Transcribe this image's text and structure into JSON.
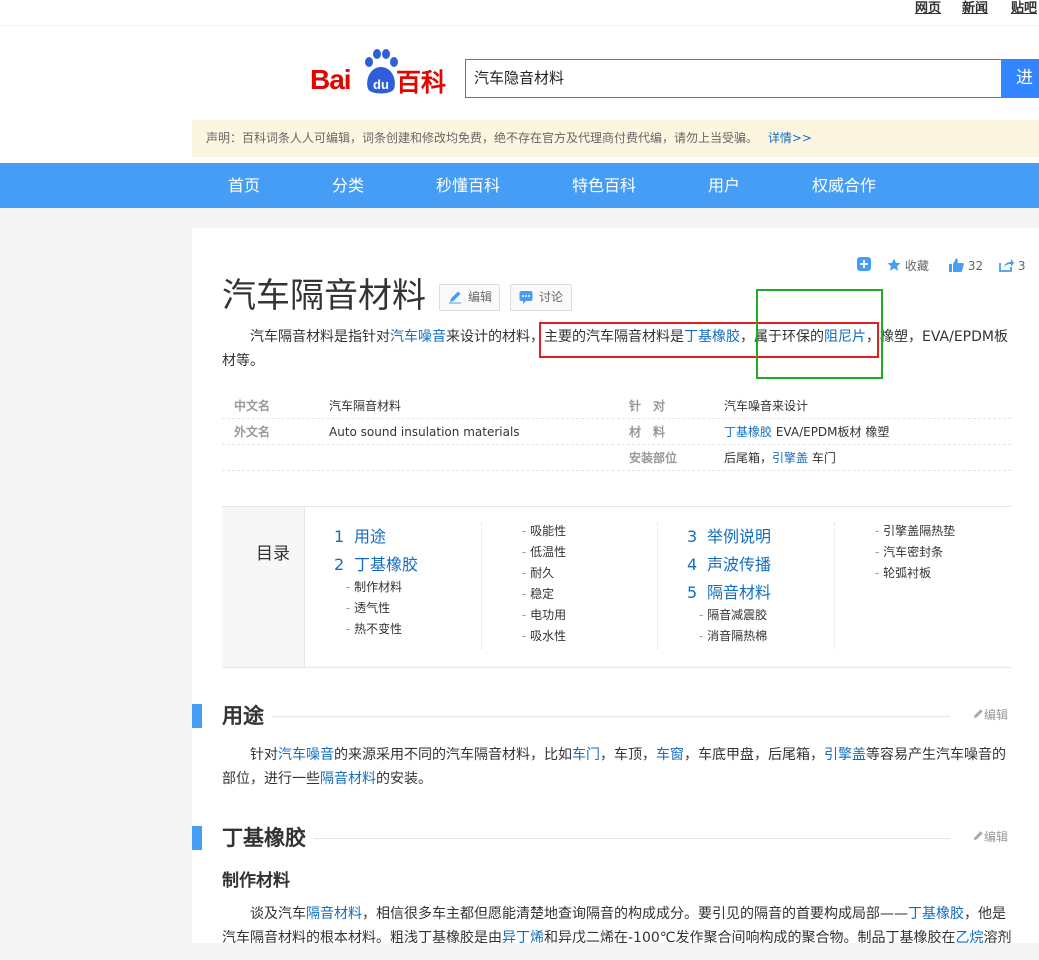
{
  "topbar": {
    "links": [
      "网页",
      "新闻",
      "贴吧"
    ]
  },
  "logo": {
    "bai": "Bai",
    "du": "du",
    "baike": "百科"
  },
  "search": {
    "value": "汽车隐音材料",
    "button": "进入"
  },
  "notice": {
    "text": "声明：百科词条人人可编辑，词条创建和修改均免费，绝不存在官方及代理商付费代编，请勿上当受骗。",
    "link": "详情>>"
  },
  "nav": [
    "首页",
    "分类",
    "秒懂百科",
    "特色百科",
    "用户",
    "权威合作"
  ],
  "tools": {
    "collect": "收藏",
    "likes": "32",
    "shares": "3"
  },
  "title": "汽车隔音材料",
  "buttons": {
    "edit": "编辑",
    "discuss": "讨论"
  },
  "summary": {
    "p1": "汽车隔音材料是指针对",
    "l1": "汽车噪音",
    "p2": "来设计的材料，主要的汽车隔音材料是",
    "l2": "丁基橡胶",
    "p3": "，属于环保的",
    "l3": "阻尼片",
    "p4": "，橡塑，EVA/EPDM板材等。"
  },
  "basic_info": {
    "left": [
      {
        "k": "中文名",
        "v": "汽车隔音材料"
      },
      {
        "k": "外文名",
        "v": "Auto sound insulation materials"
      }
    ],
    "right": [
      {
        "k": "针　对",
        "v": "汽车噪音来设计"
      },
      {
        "k": "材　料",
        "link": "丁基橡胶",
        "v": " EVA/EPDM板材 橡塑"
      },
      {
        "k": "安装部位",
        "v": "后尾箱，",
        "link": "引擎盖",
        "v2": " 车门"
      }
    ]
  },
  "catalog": {
    "title": "目录",
    "items": [
      {
        "num": "1",
        "label": "用途"
      },
      {
        "num": "2",
        "label": "丁基橡胶"
      },
      {
        "num": "3",
        "label": "举例说明"
      },
      {
        "num": "4",
        "label": "声波传播"
      },
      {
        "num": "5",
        "label": "隔音材料"
      }
    ],
    "sub2": [
      "制作材料",
      "透气性",
      "热不变性"
    ],
    "col2": [
      "吸能性",
      "低温性",
      "耐久",
      "稳定",
      "电功用",
      "吸水性"
    ],
    "sub5": [
      "隔音减震胶",
      "消音隔热棉"
    ],
    "col4": [
      "引擎盖隔热垫",
      "汽车密封条",
      "轮弧衬板"
    ]
  },
  "sections": {
    "s1": {
      "title": "用途",
      "edit": "编辑",
      "para": {
        "a": "针对",
        "l1": "汽车噪音",
        "b": "的来源采用不同的汽车隔音材料，比如",
        "l2": "车门",
        "c": "，车顶，",
        "l3": "车窗",
        "d": "，车底甲盘，后尾箱，",
        "l4": "引擎盖",
        "e": "等容易产生汽车噪音的部位，进行一些",
        "l5": "隔音材料",
        "f": "的安装。"
      }
    },
    "s2": {
      "title": "丁基橡胶",
      "edit": "编辑",
      "sub": "制作材料",
      "para": {
        "a": "谈及汽车",
        "l1": "隔音材料",
        "b": "，相信很多车主都但愿能清楚地查询隔音的构成成分。要引见的隔音的首要构成局部——",
        "l2": "丁基橡胶",
        "c": "，他是汽车隔音材料的根本材料。粗浅丁基橡胶是由",
        "l3": "异丁烯",
        "d": "和异戊二烯在-100℃发作聚合间响构成的聚合物。制品丁基橡胶在",
        "l4": "乙烷",
        "e": "溶剂"
      }
    }
  },
  "colors": {
    "nav": "#459df5",
    "link": "#136ec2",
    "red_box": "#e02020",
    "green_box": "#22aa22",
    "logo": "#e10602",
    "du": "#2e5fd8"
  }
}
